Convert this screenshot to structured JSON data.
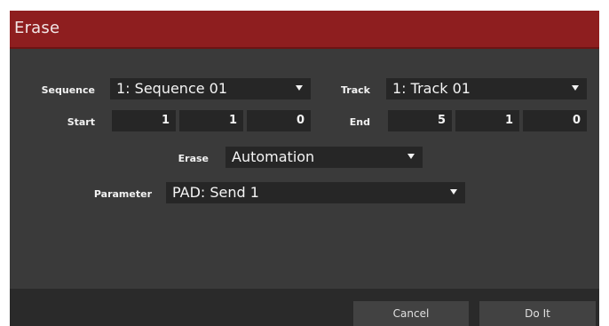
{
  "dialog": {
    "title": "Erase"
  },
  "fields": {
    "sequence": {
      "label": "Sequence",
      "value": "1: Sequence 01"
    },
    "track": {
      "label": "Track",
      "value": "1: Track 01"
    },
    "start": {
      "label": "Start",
      "values": [
        "1",
        "1",
        "0"
      ]
    },
    "end": {
      "label": "End",
      "values": [
        "5",
        "1",
        "0"
      ]
    },
    "erase": {
      "label": "Erase",
      "value": "Automation"
    },
    "parameter": {
      "label": "Parameter",
      "value": "PAD: Send 1"
    }
  },
  "footer": {
    "cancel_label": "Cancel",
    "doit_label": "Do It"
  },
  "colors": {
    "titlebar": "#8e1e1f",
    "body": "#3a3a3a",
    "field": "#262626",
    "footer": "#2a2a2a",
    "button": "#424242"
  },
  "icons": {
    "dropdown_arrow": "triangle-down"
  }
}
